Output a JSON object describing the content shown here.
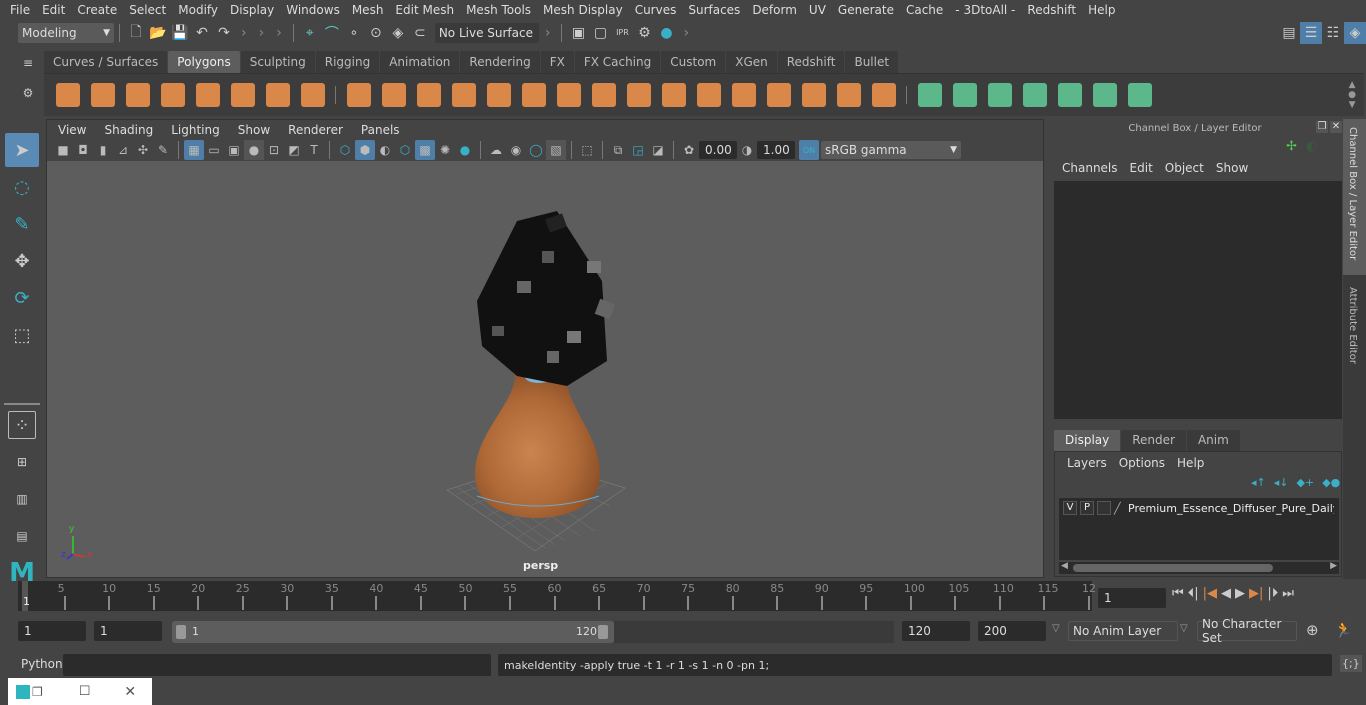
{
  "menubar": [
    "File",
    "Edit",
    "Create",
    "Select",
    "Modify",
    "Display",
    "Windows",
    "Mesh",
    "Edit Mesh",
    "Mesh Tools",
    "Mesh Display",
    "Curves",
    "Surfaces",
    "Deform",
    "UV",
    "Generate",
    "Cache",
    "- 3DtoAll -",
    "Redshift",
    "Help"
  ],
  "status_line": {
    "mode": "Modeling",
    "live_surface": "No Live Surface"
  },
  "shelf_tabs": [
    {
      "label": "Curves / Surfaces",
      "active": false
    },
    {
      "label": "Polygons",
      "active": true
    },
    {
      "label": "Sculpting",
      "active": false
    },
    {
      "label": "Rigging",
      "active": false
    },
    {
      "label": "Animation",
      "active": false
    },
    {
      "label": "Rendering",
      "active": false
    },
    {
      "label": "FX",
      "active": false
    },
    {
      "label": "FX Caching",
      "active": false
    },
    {
      "label": "Custom",
      "active": false
    },
    {
      "label": "XGen",
      "active": false
    },
    {
      "label": "Redshift",
      "active": false
    },
    {
      "label": "Bullet",
      "active": false
    }
  ],
  "shelf_icons": {
    "primitives": [
      "poly-sphere-icon",
      "poly-cube-icon",
      "poly-cylinder-icon",
      "poly-cone-icon",
      "poly-plane-icon",
      "poly-torus-icon",
      "poly-pyramid-icon",
      "poly-pipe-icon"
    ],
    "edit": [
      "combine-icon",
      "separate-icon",
      "mirror-icon",
      "smooth-icon",
      "reduce-icon",
      "bevel-icon",
      "multi-cut-icon",
      "extrude-icon",
      "bridge-icon",
      "fill-hole-icon",
      "insert-loop-icon",
      "append-icon",
      "target-weld-icon",
      "merge-icon",
      "triangulate-icon",
      "quadrangulate-icon"
    ],
    "uv": [
      "planar-uv-icon",
      "cylindrical-uv-icon",
      "spherical-uv-icon",
      "automatic-uv-icon",
      "contour-uv-icon",
      "uv-editor-icon",
      "unfold-uv-icon"
    ]
  },
  "viewport": {
    "menu": [
      "View",
      "Shading",
      "Lighting",
      "Show",
      "Renderer",
      "Panels"
    ],
    "exposure": "0.00",
    "gamma": "1.00",
    "color_space": "sRGB gamma",
    "camera_label": "persp",
    "axis": {
      "x": "x",
      "y": "y",
      "z": "z"
    }
  },
  "channel_box": {
    "title": "Channel Box / Layer Editor",
    "menu": [
      "Channels",
      "Edit",
      "Object",
      "Show"
    ],
    "layer_tabs": [
      {
        "label": "Display",
        "active": true
      },
      {
        "label": "Render",
        "active": false
      },
      {
        "label": "Anim",
        "active": false
      }
    ],
    "layer_menu": [
      "Layers",
      "Options",
      "Help"
    ],
    "layers": [
      {
        "v": "V",
        "p": "P",
        "name": "Premium_Essence_Diffuser_Pure_Daily_C"
      }
    ]
  },
  "side_tabs": [
    "Channel Box / Layer Editor",
    "Attribute Editor"
  ],
  "timeline": {
    "ticks": [
      "5",
      "10",
      "15",
      "20",
      "25",
      "30",
      "35",
      "40",
      "45",
      "50",
      "55",
      "60",
      "65",
      "70",
      "75",
      "80",
      "85",
      "90",
      "95",
      "100",
      "105",
      "110",
      "115",
      "12"
    ],
    "current_frame_marker": "1",
    "current_frame": "1"
  },
  "range": {
    "start": "1",
    "playback_start": "1",
    "slider_start": "1",
    "slider_end": "120",
    "playback_end": "120",
    "end": "200",
    "anim_layer": "No Anim Layer",
    "character_set": "No Character Set"
  },
  "command_line": {
    "language": "Python",
    "input": "",
    "result": "makeIdentity -apply true -t 1 -r 1 -s 1 -n 0 -pn 1;"
  },
  "colors": {
    "accent_blue": "#5a8bb5",
    "shelf_orange": "#d9884a",
    "shelf_green": "#5cb88a",
    "teal": "#2fb5c0"
  }
}
